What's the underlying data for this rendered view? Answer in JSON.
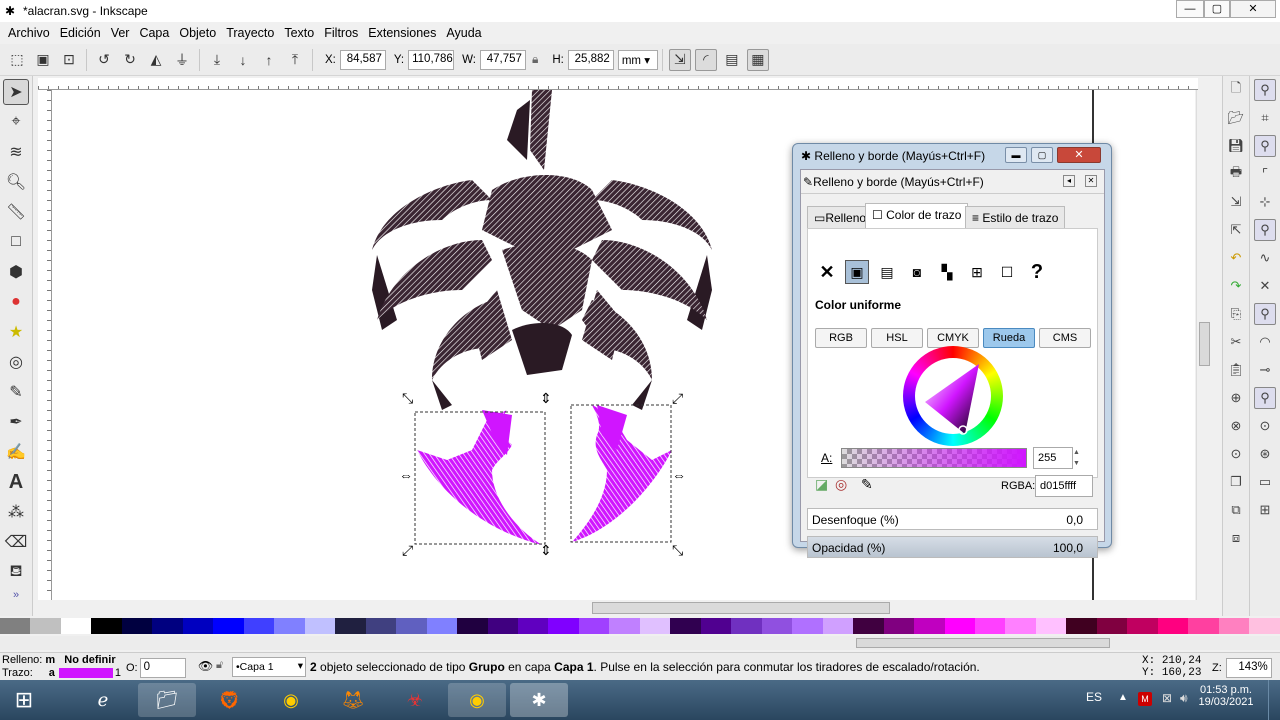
{
  "window": {
    "title": "*alacran.svg - Inkscape",
    "minimize": "—",
    "maximize": "▢",
    "close": "✕"
  },
  "menu": [
    "Archivo",
    "Edición",
    "Ver",
    "Capa",
    "Objeto",
    "Trayecto",
    "Texto",
    "Filtros",
    "Extensiones",
    "Ayuda"
  ],
  "toolbar": {
    "x_label": "X:",
    "x_value": "84,587",
    "y_label": "Y:",
    "y_value": "110,786",
    "w_label": "W:",
    "w_value": "47,757",
    "h_label": "H:",
    "h_value": "25,882",
    "unit": "mm"
  },
  "dialog": {
    "window_title": "Relleno y borde (Mayús+Ctrl+F)",
    "panel_title": "Relleno y borde (Mayús+Ctrl+F)",
    "tabs": [
      "Relleno",
      "Color de trazo",
      "Estilo de trazo"
    ],
    "paint_section_label": "Color uniforme",
    "modes": [
      "RGB",
      "HSL",
      "CMYK",
      "Rueda",
      "CMS"
    ],
    "alpha_label": "A:",
    "alpha_value": "255",
    "rgba_label": "RGBA:",
    "rgba_value": "d015ffff",
    "blur_label": "Desenfoque (%)",
    "blur_value": "0,0",
    "opacity_label": "Opacidad (%)",
    "opacity_value": "100,0",
    "selected_color": "#d015ff"
  },
  "status": {
    "fill_label": "Relleno:",
    "fill_value": "m",
    "fill_state": "No definir",
    "stroke_label": "Trazo:",
    "stroke_value": "a",
    "stroke_width": "1",
    "opacity_label": "O:",
    "opacity_value": "0",
    "layer": "•Capa 1",
    "message_count": "2",
    "message_1": " objeto seleccionado de tipo ",
    "message_type": "Grupo",
    "message_2": " en capa ",
    "message_layer": "Capa 1",
    "message_3": ". Pulse en la selección para conmutar los tiradores de escalado/rotación.",
    "coord_x_label": "X:",
    "coord_x": "210,24",
    "coord_y_label": "Y:",
    "coord_y": "160,23",
    "zoom_label": "Z:",
    "zoom": "143%"
  },
  "taskbar": {
    "lang": "ES",
    "time": "01:53 p.m.",
    "date": "19/03/2021"
  },
  "colors": {
    "accent_magenta": "#d015ff",
    "scorpion_dark": "#2a1a24"
  }
}
